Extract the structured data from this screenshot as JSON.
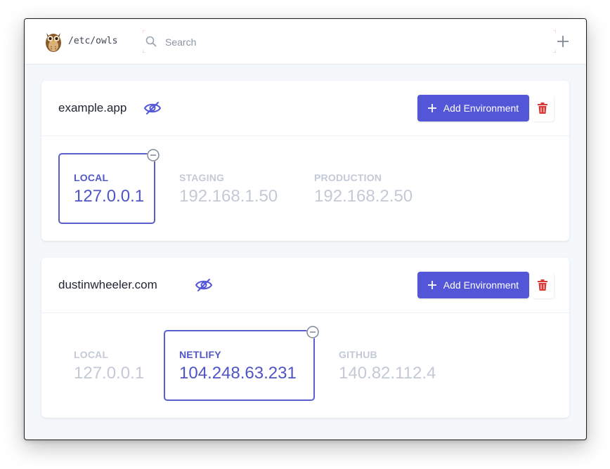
{
  "app": {
    "title": "/etc/owls",
    "logo_icon": "owl-icon"
  },
  "search": {
    "placeholder": "Search",
    "value": ""
  },
  "colors": {
    "accent": "#5356d6",
    "delete": "#d93a36",
    "active_env": "#5157c4",
    "inactive_env": "#c3cad6"
  },
  "sites": [
    {
      "name": "example.app",
      "add_env_label": "Add Environment",
      "environments": [
        {
          "name": "LOCAL",
          "ip": "127.0.0.1",
          "active": true
        },
        {
          "name": "STAGING",
          "ip": "192.168.1.50",
          "active": false
        },
        {
          "name": "PRODUCTION",
          "ip": "192.168.2.50",
          "active": false
        }
      ]
    },
    {
      "name": "dustinwheeler.com",
      "add_env_label": "Add Environment",
      "environments": [
        {
          "name": "LOCAL",
          "ip": "127.0.0.1",
          "active": false
        },
        {
          "name": "NETLIFY",
          "ip": "104.248.63.231",
          "active": true
        },
        {
          "name": "GITHUB",
          "ip": "140.82.112.4",
          "active": false
        }
      ]
    }
  ]
}
